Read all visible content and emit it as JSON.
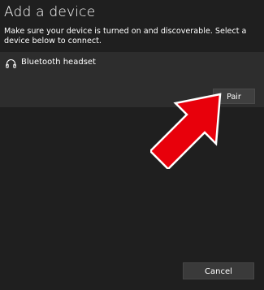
{
  "dialog": {
    "title": "Add a device",
    "description": "Make sure your device is turned on and discoverable. Select a device below to connect."
  },
  "devices": [
    {
      "name": "Bluetooth headset",
      "icon": "headphones-icon",
      "action_label": "Pair"
    }
  ],
  "footer": {
    "cancel_label": "Cancel"
  },
  "colors": {
    "background": "#1f1f1f",
    "card": "#2d2d2d",
    "button": "#3f3f3f",
    "arrow": "#e8000b"
  }
}
